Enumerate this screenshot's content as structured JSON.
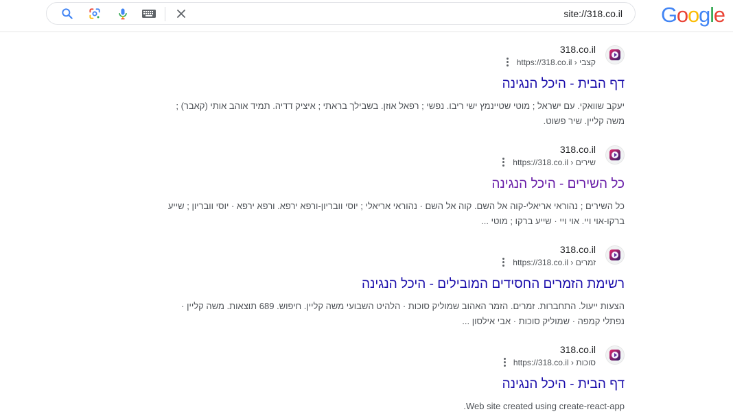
{
  "search": {
    "query": "site://318.co.il",
    "icons": {
      "search": "search-icon",
      "lens": "google-lens-icon",
      "voice": "microphone-icon",
      "keyboard": "keyboard-icon",
      "clear": "close-icon"
    }
  },
  "logo": {
    "letters": [
      {
        "ch": "G",
        "color": "#4285F4"
      },
      {
        "ch": "o",
        "color": "#EA4335"
      },
      {
        "ch": "o",
        "color": "#FBBC05"
      },
      {
        "ch": "g",
        "color": "#4285F4"
      },
      {
        "ch": "l",
        "color": "#34A853"
      },
      {
        "ch": "e",
        "color": "#EA4335"
      }
    ]
  },
  "colors": {
    "link": "#1a0dab",
    "visited_link": "#681da8",
    "snippet": "#4d5156"
  },
  "results": [
    {
      "site_name": "318.co.il",
      "url": "https://318.co.il › קצבי",
      "title": "דף הבית - היכל הנגינה",
      "visited": false,
      "snippet": "יעקב שוואקי. עם ישראל ; מוטי שטיינמץ ישי ריבו. נפשי ; רפאל אוזן. בשבילך בראתי ; איציק דדיה. תמיד אוהב אותי (קאבר) ; משה קליין. שיר פשוט."
    },
    {
      "site_name": "318.co.il",
      "url": "https://318.co.il › שירים",
      "title": "כל השירים - היכל הנגינה",
      "visited": true,
      "snippet": "כל השירים ; נהוראי אריאלי-קוה אל השם. קוה אל השם · נהוראי אריאלי ; יוסי וובריון-ורפא ירפא. ורפא ירפא · יוסי וובריון ; שייע ברקו-אוי ויי. אוי ויי · שייע ברקו ; מוטי ..."
    },
    {
      "site_name": "318.co.il",
      "url": "https://318.co.il › זמרים",
      "title": "רשימת הזמרים החסידים המובילים - היכל הנגינה",
      "visited": false,
      "snippet": "הצעות ייעול. התחברות. זמרים. הזמר האהוב שמוליק סוכות · הלהיט השבועי משה קליין. חיפוש. 689 תוצאות. משה קליין · נפתלי קמפה · שמוליק סוכות · אבי אילסון ..."
    },
    {
      "site_name": "318.co.il",
      "url": "https://318.co.il › סוכות",
      "title": "דף הבית - היכל הנגינה",
      "visited": false,
      "snippet": "Web site created using create-react-app."
    }
  ]
}
